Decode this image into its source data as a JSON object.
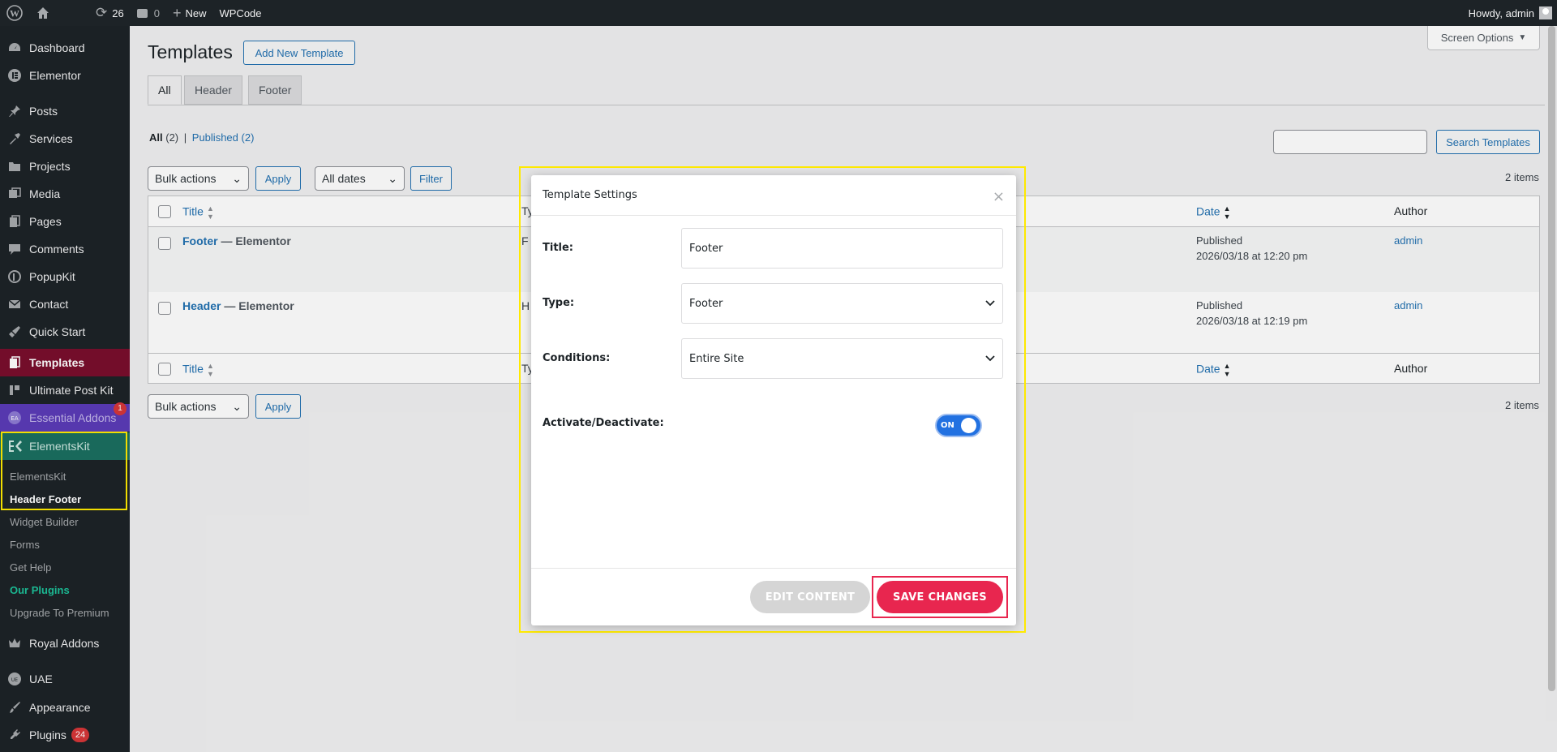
{
  "adminbar": {
    "updates_count": "26",
    "comments_count": "0",
    "new_label": "New",
    "wpcode_label": "WPCode",
    "howdy": "Howdy, admin"
  },
  "sidebar": {
    "items": [
      {
        "label": "Dashboard",
        "icon": "dashboard-icon"
      },
      {
        "label": "Elementor",
        "icon": "elementor-icon"
      },
      {
        "label": "Posts",
        "icon": "pin-icon"
      },
      {
        "label": "Services",
        "icon": "hammer-icon"
      },
      {
        "label": "Projects",
        "icon": "folder-icon"
      },
      {
        "label": "Media",
        "icon": "media-icon"
      },
      {
        "label": "Pages",
        "icon": "pages-icon"
      },
      {
        "label": "Comments",
        "icon": "comment-icon"
      },
      {
        "label": "PopupKit",
        "icon": "popupkit-icon"
      },
      {
        "label": "Contact",
        "icon": "mail-icon"
      },
      {
        "label": "Quick Start",
        "icon": "rocket-icon"
      },
      {
        "label": "Templates",
        "icon": "templates-icon"
      },
      {
        "label": "Ultimate Post Kit",
        "icon": "upk-icon"
      },
      {
        "label": "Essential Addons",
        "icon": "ea-icon",
        "badge": "1"
      },
      {
        "label": "ElementsKit",
        "icon": "ekit-icon"
      },
      {
        "label": "Royal Addons",
        "icon": "crown-icon"
      },
      {
        "label": "UAE",
        "icon": "uae-icon"
      },
      {
        "label": "Appearance",
        "icon": "brush-icon"
      },
      {
        "label": "Plugins",
        "icon": "plug-icon",
        "badge": "24"
      }
    ],
    "submenu": [
      "ElementsKit",
      "Header Footer",
      "Widget Builder",
      "Forms",
      "Get Help",
      "Our Plugins",
      "Upgrade To Premium"
    ]
  },
  "page": {
    "title": "Templates",
    "add_new": "Add New Template",
    "screen_options": "Screen Options",
    "tabs": [
      "All",
      "Header",
      "Footer"
    ],
    "views_all": "All",
    "views_all_count": "(2)",
    "views_sep": "|",
    "views_published": "Published",
    "views_published_count": "(2)",
    "bulk_actions": "Bulk actions",
    "apply": "Apply",
    "all_dates": "All dates",
    "filter": "Filter",
    "search_button": "Search Templates",
    "items_count": "2 items"
  },
  "table": {
    "col_title": "Title",
    "col_type_partial": "Ty",
    "col_date": "Date",
    "col_author": "Author",
    "rows": [
      {
        "title": "Footer",
        "suffix": "— Elementor",
        "type_partial": "F",
        "status": "Published",
        "date": "2026/03/18 at 12:20 pm",
        "author": "admin"
      },
      {
        "title": "Header",
        "suffix": "— Elementor",
        "type_partial": "H",
        "status": "Published",
        "date": "2026/03/18 at 12:19 pm",
        "author": "admin"
      }
    ]
  },
  "modal": {
    "heading": "Template Settings",
    "close": "×",
    "title_label": "Title:",
    "title_value": "Footer",
    "type_label": "Type:",
    "type_value": "Footer",
    "conditions_label": "Conditions:",
    "conditions_value": "Entire Site",
    "activate_label": "Activate/Deactivate:",
    "toggle_state": "ON",
    "edit_button": "EDIT CONTENT",
    "save_button": "SAVE CHANGES"
  },
  "colors": {
    "accent": "#2271b1",
    "save": "#e8264f",
    "toggle": "#2271e1",
    "highlight": "#ffea00"
  }
}
